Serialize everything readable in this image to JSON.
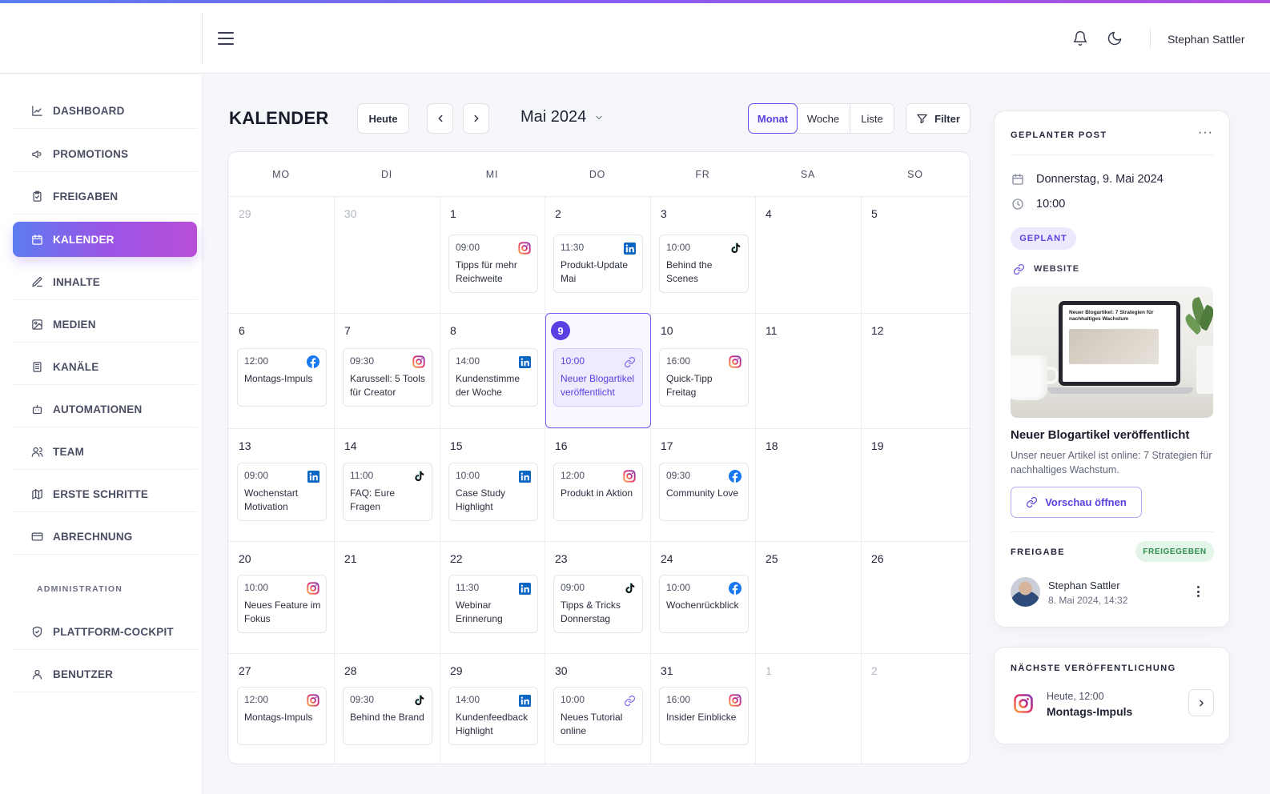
{
  "header": {
    "user_name": "Stephan Sattler",
    "bell_icon": "bell-icon",
    "theme_icon": "moon-icon"
  },
  "sidebar": {
    "items": [
      {
        "label": "DASHBOARD",
        "icon": "chart-icon"
      },
      {
        "label": "PROMOTIONS",
        "icon": "megaphone-icon"
      },
      {
        "label": "FREIGABEN",
        "icon": "clipboard-check-icon"
      },
      {
        "label": "KALENDER",
        "icon": "calendar-icon",
        "active": true
      },
      {
        "label": "INHALTE",
        "icon": "edit-icon"
      },
      {
        "label": "MEDIEN",
        "icon": "image-icon"
      },
      {
        "label": "KANÄLE",
        "icon": "building-icon"
      },
      {
        "label": "AUTOMATIONEN",
        "icon": "robot-icon"
      },
      {
        "label": "TEAM",
        "icon": "users-icon"
      },
      {
        "label": "ERSTE SCHRITTE",
        "icon": "map-icon"
      },
      {
        "label": "ABRECHNUNG",
        "icon": "credit-card-icon"
      }
    ],
    "section_admin": "ADMINISTRATION",
    "admin_items": [
      {
        "label": "PLATTFORM-COCKPIT",
        "icon": "shield-icon"
      },
      {
        "label": "BENUTZER",
        "icon": "user-icon"
      }
    ]
  },
  "toolbar": {
    "title": "KALENDER",
    "today_label": "Heute",
    "month_label": "Mai 2024",
    "views": [
      "Monat",
      "Woche",
      "Liste"
    ],
    "active_view": "Monat",
    "filter_label": "Filter"
  },
  "calendar": {
    "weekdays": [
      "MO",
      "DI",
      "MI",
      "DO",
      "FR",
      "SA",
      "SO"
    ],
    "weeks": [
      [
        "29",
        "30",
        "1",
        "2",
        "3",
        "4",
        "5"
      ],
      [
        "6",
        "7",
        "8",
        "9",
        "10",
        "11",
        "12"
      ],
      [
        "13",
        "14",
        "15",
        "16",
        "17",
        "18",
        "19"
      ],
      [
        "20",
        "21",
        "22",
        "23",
        "24",
        "25",
        "26"
      ],
      [
        "27",
        "28",
        "29",
        "30",
        "31",
        "1",
        "2"
      ]
    ],
    "today": "9",
    "events": [
      {
        "week": 0,
        "day": 2,
        "time": "09:00",
        "title": "Tipps für mehr Reichweite",
        "platform": "instagram"
      },
      {
        "week": 0,
        "day": 3,
        "time": "11:30",
        "title": "Produkt-Update Mai",
        "platform": "linkedin"
      },
      {
        "week": 0,
        "day": 4,
        "time": "10:00",
        "title": "Behind the Scenes",
        "platform": "tiktok"
      },
      {
        "week": 1,
        "day": 0,
        "time": "12:00",
        "title": "Montags-Impuls",
        "platform": "facebook"
      },
      {
        "week": 1,
        "day": 1,
        "time": "09:30",
        "title": "Karussell: 5 Tools für Creator",
        "platform": "instagram"
      },
      {
        "week": 1,
        "day": 2,
        "time": "14:00",
        "title": "Kundenstimme der Woche",
        "platform": "linkedin"
      },
      {
        "week": 1,
        "day": 3,
        "time": "10:00",
        "title": "Neuer Blogartikel veröffentlicht",
        "platform": "link",
        "selected": true
      },
      {
        "week": 1,
        "day": 4,
        "time": "16:00",
        "title": "Quick-Tipp Freitag",
        "platform": "instagram"
      },
      {
        "week": 2,
        "day": 0,
        "time": "09:00",
        "title": "Wochenstart Motivation",
        "platform": "linkedin"
      },
      {
        "week": 2,
        "day": 1,
        "time": "11:00",
        "title": "FAQ: Eure Fragen",
        "platform": "tiktok"
      },
      {
        "week": 2,
        "day": 2,
        "time": "10:00",
        "title": "Case Study Highlight",
        "platform": "linkedin"
      },
      {
        "week": 2,
        "day": 3,
        "time": "12:00",
        "title": "Produkt in Aktion",
        "platform": "instagram"
      },
      {
        "week": 2,
        "day": 4,
        "time": "09:30",
        "title": "Community Love",
        "platform": "facebook"
      },
      {
        "week": 3,
        "day": 0,
        "time": "10:00",
        "title": "Neues Feature im Fokus",
        "platform": "instagram"
      },
      {
        "week": 3,
        "day": 2,
        "time": "11:30",
        "title": "Webinar Erinnerung",
        "platform": "linkedin"
      },
      {
        "week": 3,
        "day": 3,
        "time": "09:00",
        "title": "Tipps & Tricks Donnerstag",
        "platform": "tiktok"
      },
      {
        "week": 3,
        "day": 4,
        "time": "10:00",
        "title": "Wochenrückblick",
        "platform": "facebook"
      },
      {
        "week": 4,
        "day": 0,
        "time": "12:00",
        "title": "Montags-Impuls",
        "platform": "instagram"
      },
      {
        "week": 4,
        "day": 1,
        "time": "09:30",
        "title": "Behind the Brand",
        "platform": "tiktok"
      },
      {
        "week": 4,
        "day": 2,
        "time": "14:00",
        "title": "Kundenfeedback Highlight",
        "platform": "linkedin"
      },
      {
        "week": 4,
        "day": 3,
        "time": "10:00",
        "title": "Neues Tutorial online",
        "platform": "link"
      },
      {
        "week": 4,
        "day": 4,
        "time": "16:00",
        "title": "Insider Einblicke",
        "platform": "instagram"
      }
    ]
  },
  "detail": {
    "title": "GEPLANTER POST",
    "menu_icon": "more-horizontal-icon",
    "date": "Donnerstag, 9. Mai 2024",
    "time": "10:00",
    "status": "GEPLANT",
    "channel": "WEBSITE",
    "preview_heading": "Neuer Blogartikel: 7 Strategien für nachhaltiges Wachstum",
    "post_title": "Neuer Blogartikel veröffentlicht",
    "post_text": "Unser neuer Artikel ist online: 7 Strategien für nachhaltiges Wachstum.",
    "preview_button": "Vorschau öffnen",
    "approval_label": "FREIGABE",
    "approval_status": "FREIGEGEBEN",
    "approver_name": "Stephan Sattler",
    "approver_date": "8. Mai 2024, 14:32"
  },
  "next": {
    "title": "NÄCHSTE VERÖFFENTLICHUNG",
    "when": "Heute, 12:00",
    "post": "Montags-Impuls",
    "platform": "instagram"
  },
  "colors": {
    "accent": "#5b3fe0",
    "gradient_start": "#5b7cf0",
    "gradient_end": "#b84ed8",
    "instagram": "#e1306c",
    "linkedin": "#0a66c2",
    "facebook": "#1877f2",
    "tiktok": "#111111",
    "approved_bg": "#e3f5e8",
    "approved_text": "#2f8f4e"
  }
}
